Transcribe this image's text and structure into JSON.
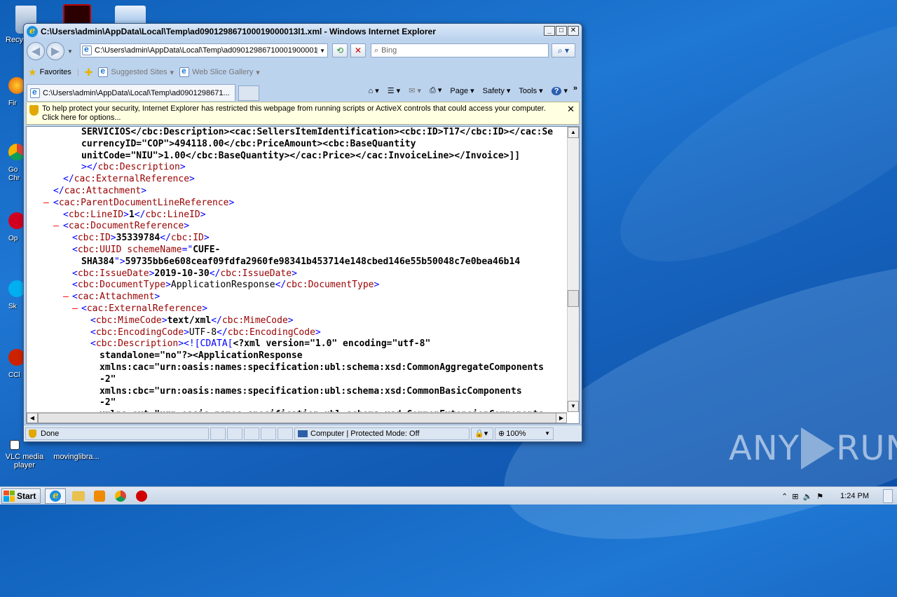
{
  "window": {
    "title": "C:\\Users\\admin\\AppData\\Local\\Temp\\ad090129867100019000013l1.xml - Windows Internet Explorer"
  },
  "address": {
    "url": "C:\\Users\\admin\\AppData\\Local\\Temp\\ad09012986710001900001"
  },
  "search": {
    "placeholder": "Bing"
  },
  "favorites": {
    "label": "Favorites",
    "suggested": "Suggested Sites",
    "webslice": "Web Slice Gallery"
  },
  "tab": {
    "label": "C:\\Users\\admin\\AppData\\Local\\Temp\\ad0901298671..."
  },
  "commands": {
    "page": "Page",
    "safety": "Safety",
    "tools": "Tools"
  },
  "infobar": {
    "text": "To help protect your security, Internet Explorer has restricted this webpage from running scripts or ActiveX controls that could access your computer. Click here for options..."
  },
  "statusbar": {
    "status": "Done",
    "zone": "Computer | Protected Mode: Off",
    "zoom": "100%"
  },
  "desktop": {
    "icons": [
      {
        "label": "Recy"
      },
      {
        "label": "VLC media player"
      },
      {
        "label": "movinglibra..."
      }
    ],
    "peek_labels": [
      "Fir",
      "Go Chr",
      "Op",
      "Sk",
      "CCl"
    ]
  },
  "taskbar": {
    "start": "Start",
    "clock": "1:24 PM"
  },
  "watermark": {
    "left": "ANY",
    "right": "RUN"
  }
}
